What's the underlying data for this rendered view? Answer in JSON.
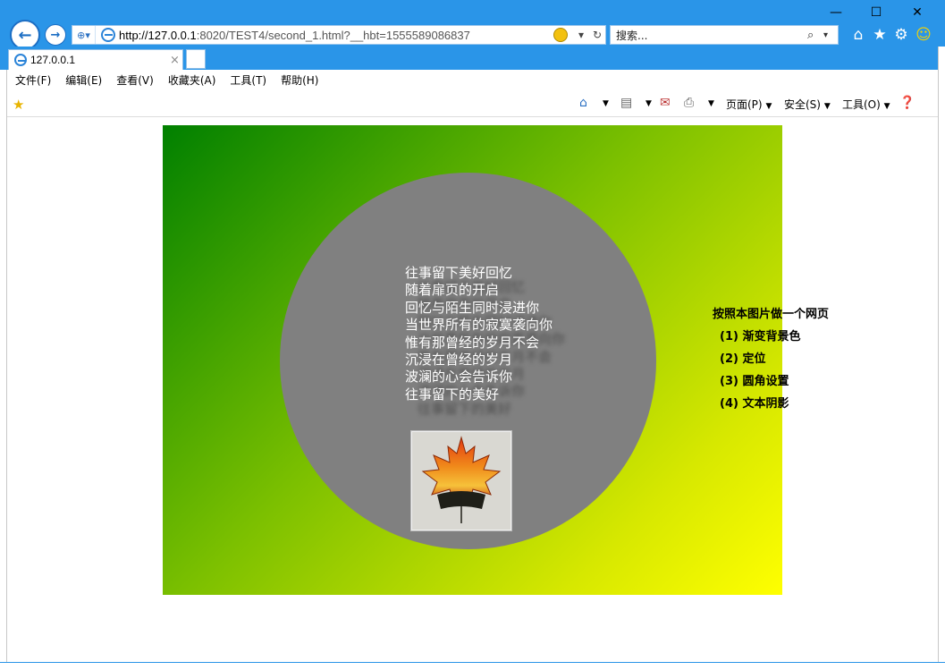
{
  "window": {
    "minimize": "—",
    "maximize": "☐",
    "close": "✕"
  },
  "address_bar": {
    "url_host": "http://127.0.0.1",
    "url_rest": ":8020/TEST4/second_1.html?__hbt=1555589086837"
  },
  "search_bar": {
    "placeholder": "搜索..."
  },
  "tab": {
    "title": "127.0.0.1"
  },
  "menu": [
    "文件(F)",
    "编辑(E)",
    "查看(V)",
    "收藏夹(A)",
    "工具(T)",
    "帮助(H)"
  ],
  "command_bar": {
    "page": "页面(P)",
    "safety": "安全(S)",
    "tools": "工具(O)"
  },
  "poem": {
    "lines": [
      "往事留下美好回忆",
      "随着扉页的开启",
      "回忆与陌生同时浸进你",
      "当世界所有的寂寞袭向你",
      "惟有那曾经的岁月不会",
      "沉浸在曾经的岁月",
      "波澜的心会告诉你",
      "往事留下的美好"
    ]
  },
  "requirements": {
    "title": "按照本图片做一个网页",
    "items": [
      "(1)  渐变背景色",
      "(2)  定位",
      "(3)  圆角设置",
      "(4)  文本阴影"
    ]
  },
  "colors": {
    "gradient_start": "#008000",
    "gradient_end": "#ffff00",
    "circle": "#808080",
    "chrome_blue": "#2a95e8"
  }
}
